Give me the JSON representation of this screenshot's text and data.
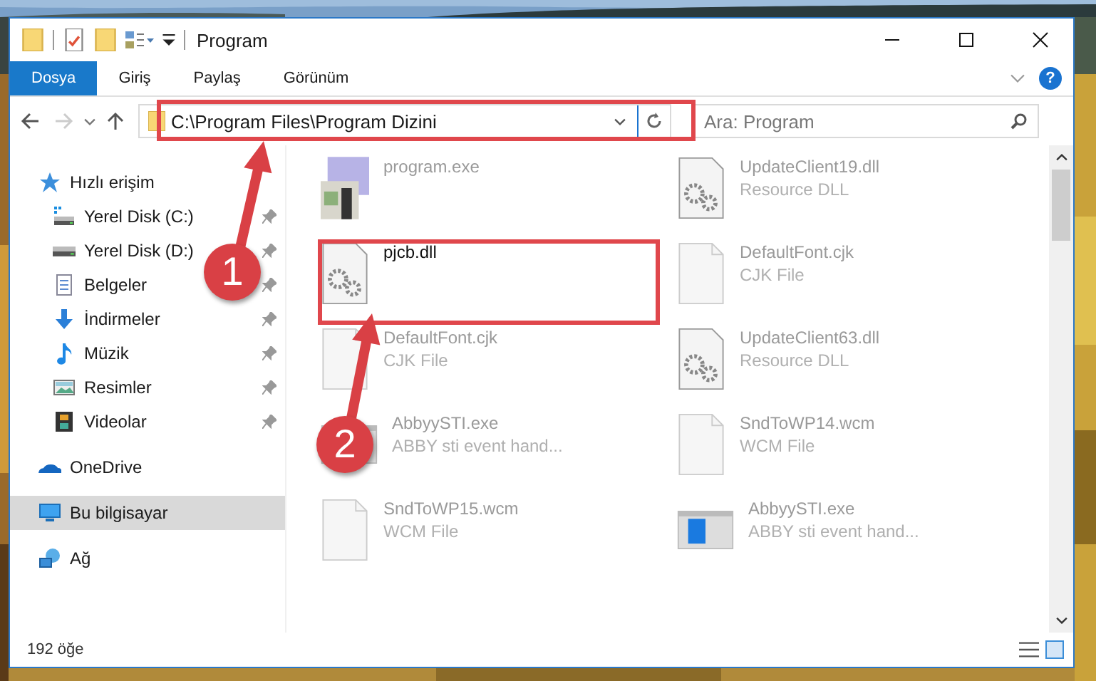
{
  "window": {
    "title": "Program"
  },
  "ribbon": {
    "tabs": [
      {
        "label": "Dosya",
        "selected": true
      },
      {
        "label": "Giriş",
        "selected": false
      },
      {
        "label": "Paylaş",
        "selected": false
      },
      {
        "label": "Görünüm",
        "selected": false
      }
    ],
    "help": "?"
  },
  "address": {
    "path": "C:\\Program Files\\Program Dizini",
    "highlighted": true
  },
  "search": {
    "placeholder": "Ara: Program"
  },
  "sidebar": {
    "items": [
      {
        "label": "Hızlı erişim",
        "kind": "star",
        "selected": false,
        "children": [
          {
            "label": "Yerel Disk (C:)",
            "kind": "drivec",
            "pinned": true
          },
          {
            "label": "Yerel Disk (D:)",
            "kind": "drive",
            "pinned": true
          },
          {
            "label": "Belgeler",
            "kind": "docs",
            "pinned": true
          },
          {
            "label": "İndirmeler",
            "kind": "down",
            "pinned": true
          },
          {
            "label": "Müzik",
            "kind": "music",
            "pinned": true
          },
          {
            "label": "Resimler",
            "kind": "pictures",
            "pinned": true
          },
          {
            "label": "Videolar",
            "kind": "video",
            "pinned": true
          }
        ]
      },
      {
        "label": "OneDrive",
        "kind": "cloud",
        "selected": false
      },
      {
        "label": "Bu bilgisayar",
        "kind": "pc",
        "selected": true
      },
      {
        "label": "Ağ",
        "kind": "network",
        "selected": false
      }
    ]
  },
  "files": [
    {
      "name": "program.exe",
      "kind": "app",
      "highlighted": false
    },
    {
      "name": "UpdateClient19.dll",
      "type": "Resource DLL",
      "kind": "dll",
      "highlighted": false
    },
    {
      "name": "pjcb.dll",
      "kind": "dll",
      "highlighted": true
    },
    {
      "name": "DefaultFont.cjk",
      "type": "CJK File",
      "kind": "blank",
      "highlighted": false
    },
    {
      "name": "DefaultFont.cjk",
      "type": "CJK File",
      "kind": "blank",
      "highlighted": false
    },
    {
      "name": "UpdateClient63.dll",
      "type": "Resource DLL",
      "kind": "dll",
      "highlighted": false
    },
    {
      "name": "AbbyySTI.exe",
      "type": "ABBY sti event hand...",
      "kind": "window",
      "highlighted": false
    },
    {
      "name": "SndToWP14.wcm",
      "type": "WCM File",
      "kind": "blank",
      "highlighted": false
    },
    {
      "name": "SndToWP15.wcm",
      "type": "WCM File",
      "kind": "blank",
      "highlighted": false
    },
    {
      "name": "AbbyySTI.exe",
      "type": "ABBY sti event hand...",
      "kind": "window",
      "highlighted": false
    }
  ],
  "status_bar": {
    "count": "192 öğe"
  },
  "annotations": [
    {
      "number": "1"
    },
    {
      "number": "2"
    }
  ]
}
